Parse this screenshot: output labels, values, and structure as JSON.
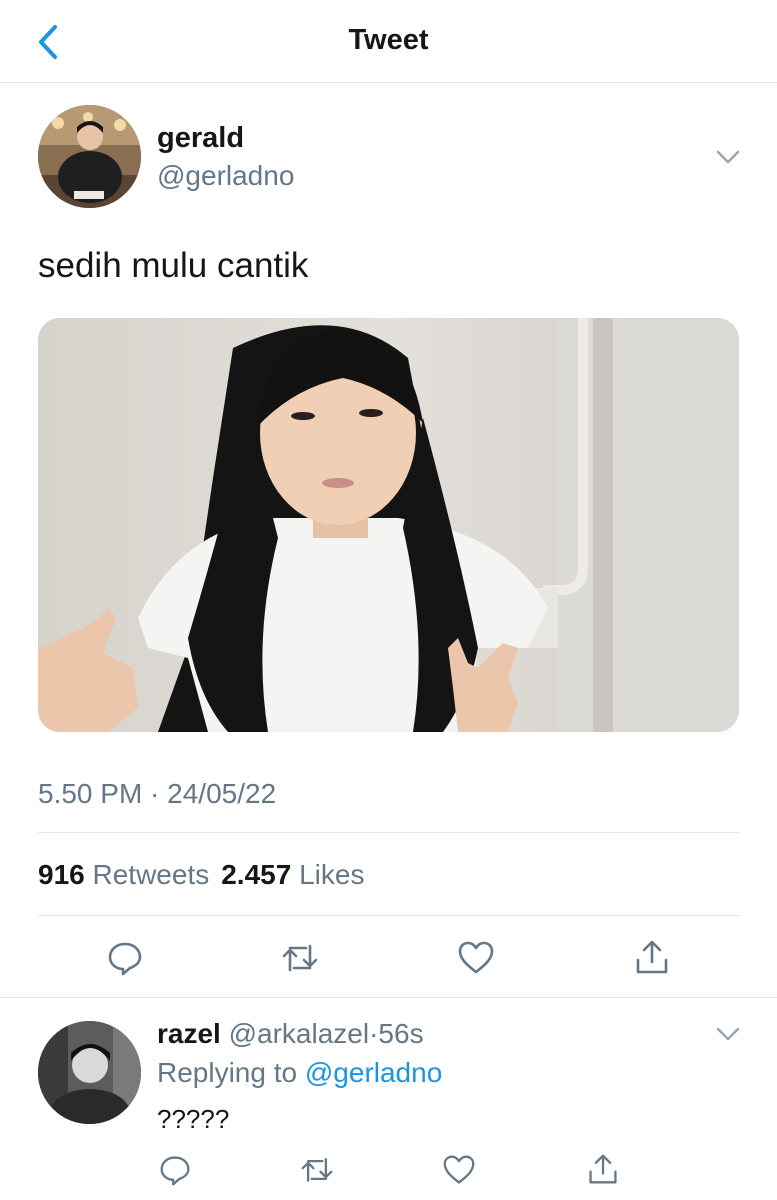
{
  "header": {
    "title": "Tweet"
  },
  "tweet": {
    "author_name": "gerald",
    "author_handle": "@gerladno",
    "text": "sedih mulu cantik",
    "timestamp": "5.50 PM · 24/05/22",
    "retweets_count": "916",
    "retweets_label": "Retweets",
    "likes_count": "2.457",
    "likes_label": "Likes"
  },
  "icons": {
    "back": "chevron-left-icon",
    "more": "chevron-down-icon",
    "reply": "speech-bubble-icon",
    "retweet": "retweet-arrows-icon",
    "like": "heart-icon",
    "share": "share-upload-icon"
  },
  "reply": {
    "author_name": "razel",
    "author_handle": "@arkalazel",
    "separator": "·",
    "time": "56s",
    "replying_prefix": "Replying to",
    "replying_to": "@gerladno",
    "text": "?????"
  },
  "colors": {
    "accent": "#1b95e0",
    "secondary_text": "#657786",
    "divider": "#e1e8ed"
  }
}
